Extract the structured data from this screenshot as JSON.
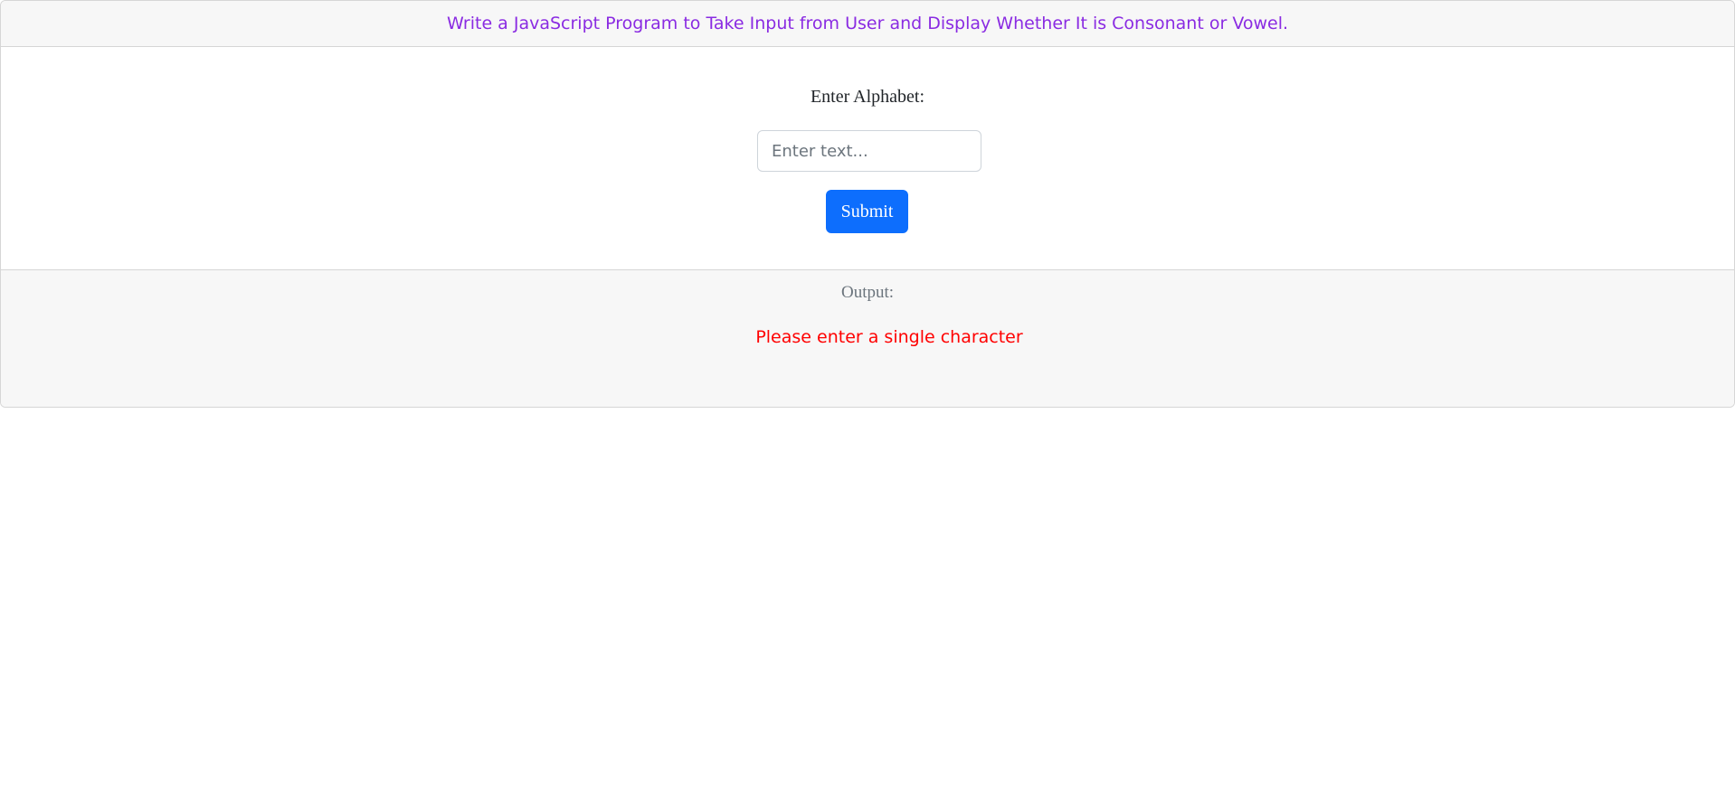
{
  "header": {
    "title": "Write a JavaScript Program to Take Input from User and Display Whether It is Consonant or Vowel."
  },
  "form": {
    "label": "Enter Alphabet:",
    "input_value": "",
    "input_placeholder": "Enter text...",
    "submit_label": "Submit"
  },
  "output": {
    "label": "Output:",
    "message": "Please enter a single character"
  },
  "colors": {
    "title": "#8a2be2",
    "submit_button": "#0d6efd",
    "error_message": "#ff0000",
    "header_background": "#f7f7f7"
  }
}
